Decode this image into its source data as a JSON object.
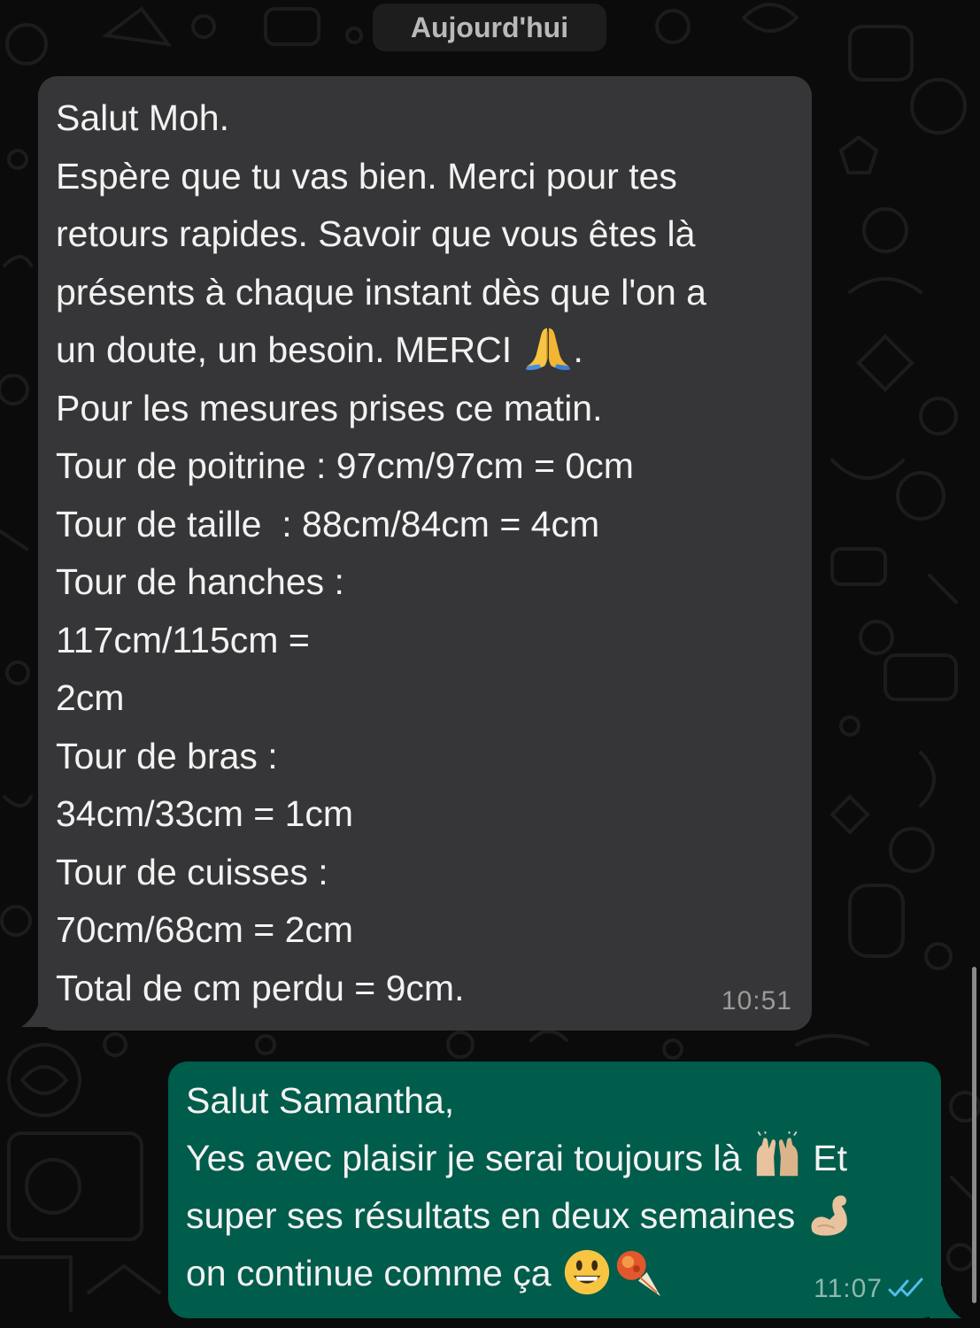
{
  "date_separator": "Aujourd'hui",
  "incoming_message": {
    "lines": [
      "Salut Moh.",
      "Espère que tu vas bien. Merci pour tes",
      "retours rapides. Savoir que vous êtes là",
      "présents à chaque instant dès que l'on a",
      "un doute, un besoin. MERCI",
      "Pour les mesures prises ce matin.",
      "Tour de poitrine : 97cm/97cm = 0cm",
      "Tour de taille  : 88cm/84cm = 4cm",
      "Tour de hanches :",
      "117cm/115cm =",
      "2cm",
      "Tour de bras :",
      "34cm/33cm = 1cm",
      "Tour de cuisses :",
      "70cm/68cm = 2cm",
      "Total de cm perdu = 9cm."
    ],
    "line5_suffix": ".",
    "time": "10:51",
    "emoji": "folded-hands-icon"
  },
  "outgoing_message": {
    "lines": [
      "Salut Samantha,",
      "Yes avec plaisir je serai toujours là",
      "super ses résultats en deux semaines",
      "on continue comme ça"
    ],
    "line2_suffix": " Et",
    "time": "11:07",
    "status": "read",
    "colors": {
      "bubble": "#005c4b",
      "read_ticks": "#53bdeb"
    }
  },
  "colors": {
    "background": "#0b0b0b",
    "incoming_bubble": "#363638",
    "text": "#f2f2f2"
  }
}
